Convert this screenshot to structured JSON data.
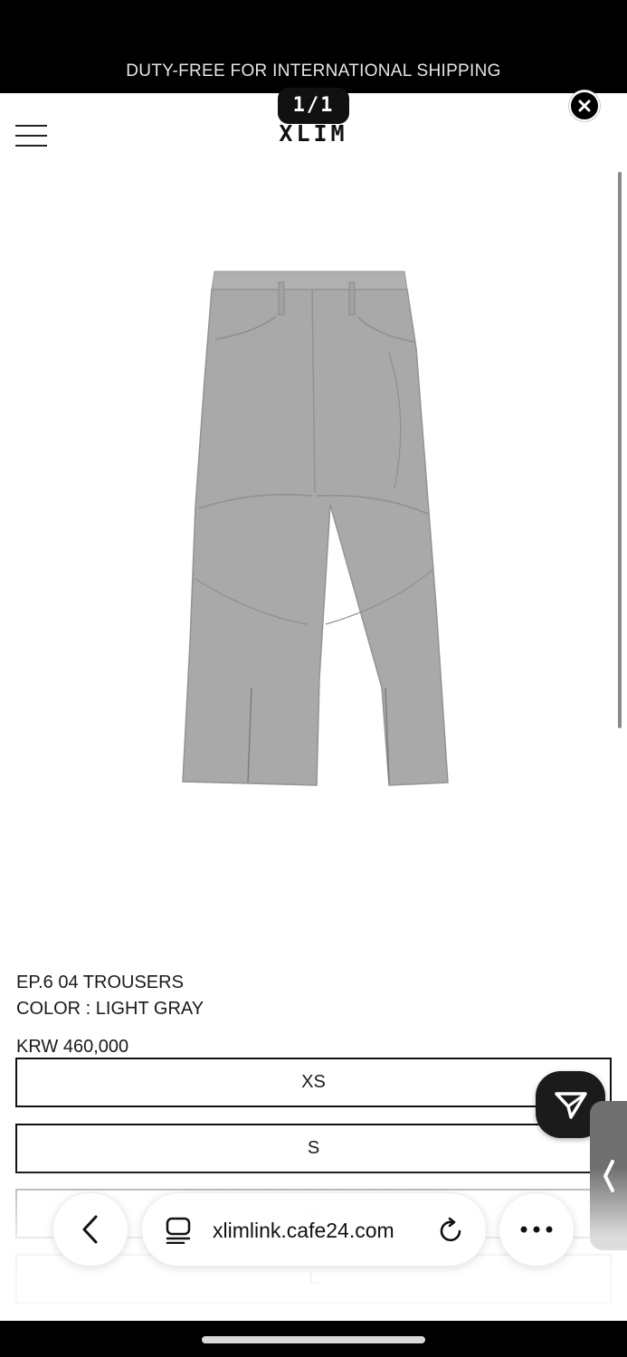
{
  "banner": {
    "text": "DUTY-FREE FOR INTERNATIONAL SHIPPING"
  },
  "header": {
    "logo": "XLIM"
  },
  "gallery": {
    "counter": "1/1"
  },
  "product": {
    "name": "EP.6 04 TROUSERS",
    "color_line": "COLOR : LIGHT GRAY",
    "price": "KRW 460,000",
    "sizes": [
      {
        "label": "XS",
        "available": true
      },
      {
        "label": "S",
        "available": true
      },
      {
        "label": "M",
        "available": false
      },
      {
        "label": "L",
        "available": false
      }
    ]
  },
  "browser": {
    "url": "xlimlink.cafe24.com"
  },
  "icons": {
    "menu": "hamburger-icon",
    "close": "close-icon",
    "send": "send-icon",
    "collapse": "chevron-left-icon",
    "back": "back-icon",
    "reader": "reader-icon",
    "reload": "reload-icon",
    "more": "more-icon"
  },
  "colors": {
    "banner_bg": "#000000",
    "accent_dark": "#1b1b1b",
    "product_gray": "#a8a8a8"
  }
}
